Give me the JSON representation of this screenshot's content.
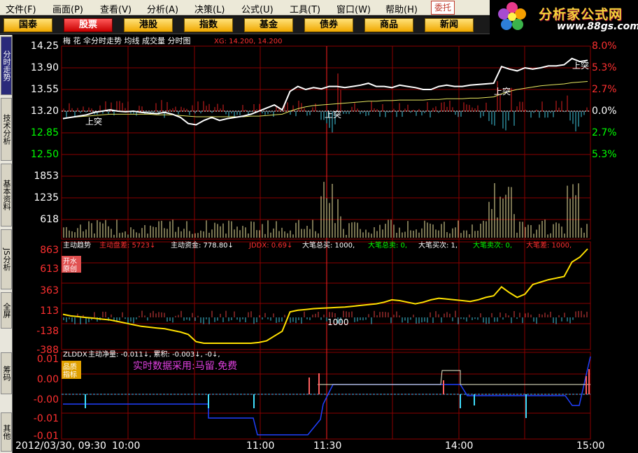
{
  "menu": [
    "文件(F)",
    "画面(P)",
    "查看(V)",
    "分析(A)",
    "决策(L)",
    "公式(U)",
    "工具(T)",
    "窗口(W)",
    "帮助(H)"
  ],
  "entrust_label": "委托",
  "logo": {
    "text": "分析家公式网",
    "url": "www.88gs.com"
  },
  "tabs": [
    "国泰",
    "股票",
    "港股",
    "指数",
    "基金",
    "债券",
    "商品",
    "新闻"
  ],
  "active_tab": 1,
  "sidebar": [
    "分时走势",
    "技术分析",
    "基本资料",
    "JS分析",
    "全屏",
    "筹码",
    "其他"
  ],
  "sidebar_active": 0,
  "panel_price": {
    "title": "梅 花 伞分时走势 均线 成交量 分时图",
    "xg_text": "XG: 14.200, 14.200",
    "y_labels": [
      "14.25",
      "13.90",
      "13.55",
      "13.20",
      "12.85",
      "12.50"
    ],
    "right_labels": [
      "8.0%",
      "5.3%",
      "2.7%",
      "0.0%",
      "2.7%",
      "5.3%"
    ],
    "vol_labels": [
      "1853",
      "1235",
      "618"
    ],
    "signal": "上突"
  },
  "panel_trend": {
    "title": "主动趋势",
    "items": [
      "主动盘差: 5723↓",
      "主动资金: 778.80↓",
      "JDDX: 0.69↓",
      "大笔总买: 1000,",
      "大笔总卖: 0,",
      "大笔买次: 1,",
      "大笔卖次: 0,",
      "大笔差: 1000,"
    ],
    "y_labels": [
      "863",
      "613",
      "363",
      "113",
      "-138",
      "-388"
    ],
    "badge": [
      "开水",
      "原创"
    ],
    "marker": "1000"
  },
  "panel_net": {
    "indicator": "ZLDDX",
    "title": "主动净量: -0.011↓, 累积: -0.003↓, -0↓,",
    "y_labels": [
      "0.01",
      "0.00",
      "-0.00",
      "-0.01",
      "-0.01"
    ],
    "badge": [
      "品质",
      "指标"
    ],
    "notice": "实时数据采用:马留.免费"
  },
  "time_axis": [
    "2012/03/30, 09:30",
    "10:00",
    "11:00",
    "11:30",
    "14:00",
    "15:00"
  ],
  "chart_data": {
    "type": "line",
    "price_series": [
      13.08,
      13.1,
      13.12,
      13.14,
      13.18,
      13.2,
      13.22,
      13.2,
      13.19,
      13.2,
      13.18,
      13.17,
      13.16,
      13.18,
      13.15,
      13.1,
      13.0,
      12.98,
      13.05,
      13.1,
      13.05,
      13.08,
      13.1,
      13.12,
      13.15,
      13.2,
      13.25,
      13.3,
      13.22,
      13.52,
      13.6,
      13.55,
      13.58,
      13.56,
      13.6,
      13.6,
      13.58,
      13.6,
      13.62,
      13.65,
      13.6,
      13.6,
      13.58,
      13.62,
      13.6,
      13.58,
      13.55,
      13.55,
      13.6,
      13.62,
      13.6,
      13.6,
      13.62,
      13.63,
      13.64,
      13.65,
      13.92,
      13.88,
      13.85,
      13.9,
      13.88,
      13.9,
      13.93,
      13.93,
      13.95,
      14.05,
      14.0,
      14.02
    ],
    "avg_series": [
      13.08,
      13.1,
      13.11,
      13.12,
      13.13,
      13.14,
      13.15,
      13.15,
      13.15,
      13.15,
      13.15,
      13.15,
      13.14,
      13.14,
      13.14,
      13.13,
      13.12,
      13.11,
      13.11,
      13.11,
      13.11,
      13.11,
      13.11,
      13.11,
      13.12,
      13.12,
      13.13,
      13.14,
      13.15,
      13.2,
      13.24,
      13.27,
      13.29,
      13.3,
      13.31,
      13.32,
      13.33,
      13.34,
      13.35,
      13.36,
      13.36,
      13.37,
      13.37,
      13.38,
      13.38,
      13.38,
      13.38,
      13.39,
      13.39,
      13.4,
      13.4,
      13.4,
      13.41,
      13.41,
      13.42,
      13.43,
      13.48,
      13.52,
      13.55,
      13.57,
      13.59,
      13.61,
      13.62,
      13.63,
      13.64,
      13.66,
      13.67,
      13.68
    ],
    "trend_series": [
      50,
      30,
      20,
      10,
      0,
      -10,
      -20,
      -40,
      -60,
      -80,
      -100,
      -110,
      -120,
      -130,
      -150,
      -170,
      -200,
      -290,
      -310,
      -310,
      -310,
      -310,
      -310,
      -310,
      -310,
      -300,
      -280,
      -220,
      -160,
      80,
      100,
      110,
      120,
      125,
      130,
      135,
      140,
      150,
      160,
      170,
      180,
      200,
      230,
      220,
      200,
      180,
      200,
      230,
      250,
      240,
      230,
      220,
      210,
      230,
      260,
      280,
      390,
      320,
      260,
      300,
      420,
      450,
      480,
      500,
      520,
      700,
      760,
      863
    ],
    "ylim_price": [
      12.5,
      14.25
    ],
    "ylim_trend": [
      -388,
      863
    ]
  }
}
